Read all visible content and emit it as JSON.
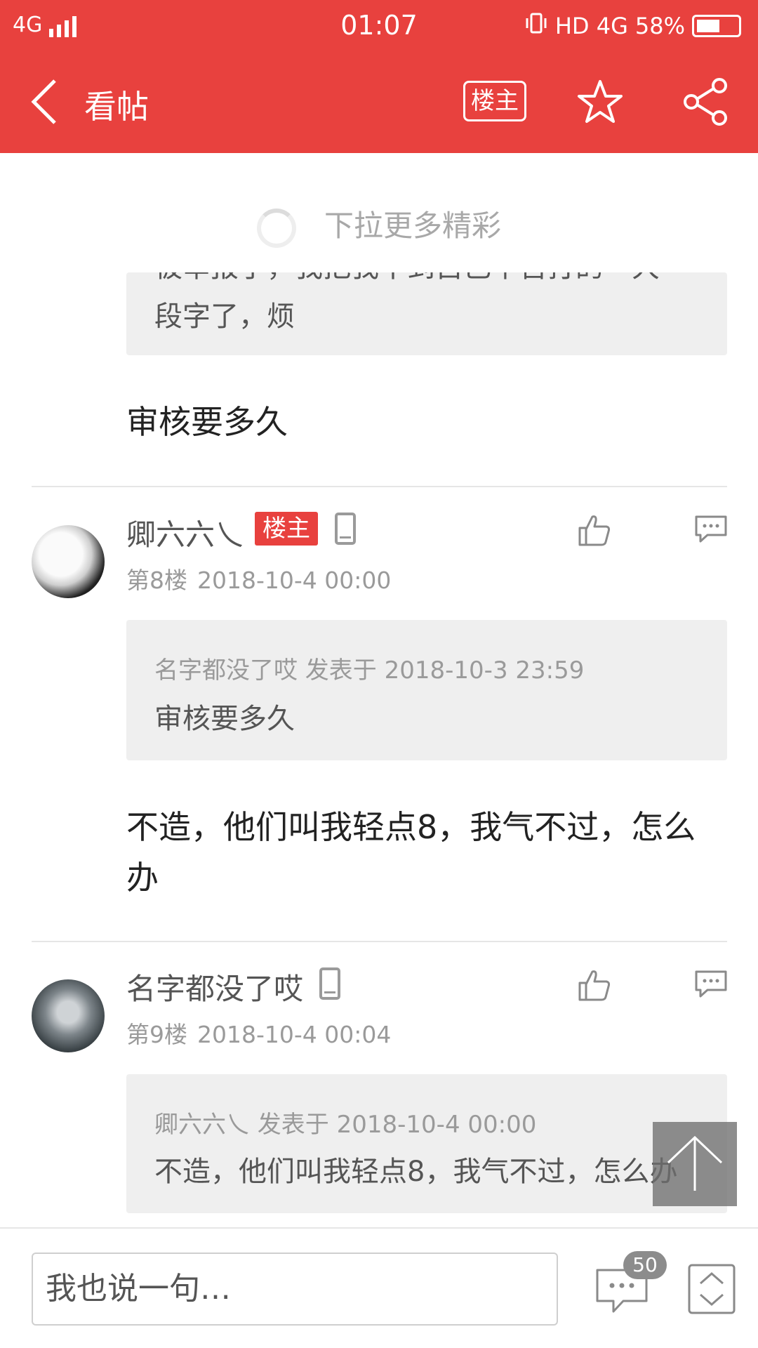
{
  "status_bar": {
    "network": "4G",
    "time": "01:07",
    "indicators": "HD 4G",
    "battery": "58%",
    "battery_level": 0.58
  },
  "header": {
    "back_icon": "chevron-left-icon",
    "title": "看帖",
    "op_button_label": "楼主",
    "star_icon": "star-icon",
    "share_icon": "share-icon"
  },
  "pull_refresh": {
    "text": "下拉更多精彩"
  },
  "partial_post": {
    "quote_text_cut": "被举报了，我把我不到自己辛苦打的一大",
    "quote_text": "段字了，烦",
    "content": "审核要多久"
  },
  "posts": [
    {
      "username": "卿六六乀",
      "badge": "楼主",
      "floor": "第8楼",
      "date": "2018-10-4 00:00",
      "quote_meta": "名字都没了哎 发表于 2018-10-3 23:59",
      "quote_text": "审核要多久",
      "content": "不造，他们叫我轻点8，我气不过，怎么办"
    },
    {
      "username": "名字都没了哎",
      "floor": "第9楼",
      "date": "2018-10-4 00:04",
      "quote_meta": "卿六六乀 发表于 2018-10-4 00:00",
      "quote_text": "不造，他们叫我轻点8，我气不过，怎么办"
    }
  ],
  "bottom_bar": {
    "input_placeholder": "我也说一句…",
    "comment_count": "50"
  },
  "colors": {
    "brand_red": "#e8413e",
    "quote_bg": "#efefef",
    "meta_gray": "#9a9a9a"
  }
}
